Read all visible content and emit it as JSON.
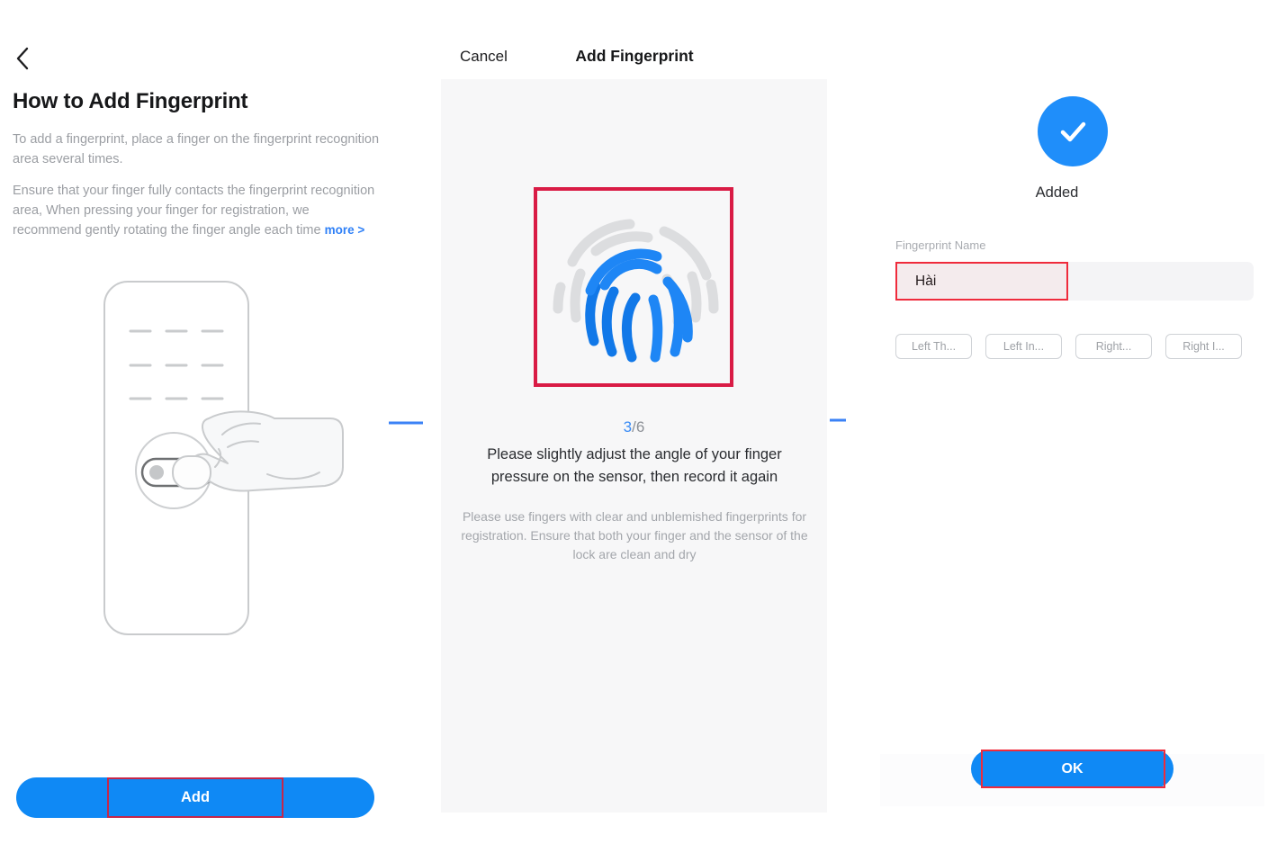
{
  "left_panel": {
    "back_icon": "chevron-left-icon",
    "title": "How to Add Fingerprint",
    "paragraph_1": "To add a fingerprint, place a finger on the fingerprint recognition area several times.",
    "paragraph_2": "Ensure that your finger fully contacts the fingerprint recognition area,  When pressing your finger for registration, we recommend gently rotating the finger angle each time ",
    "more_link": "more >",
    "illustration_name": "smart-lock-fingerprint-illustration",
    "add_button": "Add"
  },
  "middle_panel": {
    "cancel_label": "Cancel",
    "title": "Add Fingerprint",
    "fingerprint_icon": "fingerprint-icon",
    "counter_current": "3",
    "counter_separator": "/",
    "counter_total": "6",
    "instruction": "Please slightly adjust the angle of your finger pressure on the sensor, then record it again",
    "note": "Please use fingers with clear and unblemished fingerprints for registration. Ensure that both your finger and the sensor of the lock are clean and dry"
  },
  "right_panel": {
    "check_icon": "check-circle-icon",
    "status_label": "Added",
    "field_label": "Fingerprint Name",
    "field_value": "Hài",
    "field_placeholder": "Fingerprint Name",
    "chips": [
      {
        "label": "Left Th..."
      },
      {
        "label": "Left In..."
      },
      {
        "label": "Right..."
      },
      {
        "label": "Right I..."
      }
    ],
    "ok_button": "OK"
  },
  "arrows": [
    {
      "name": "flow-arrow-1"
    },
    {
      "name": "flow-arrow-2"
    }
  ],
  "colors": {
    "accent_blue": "#0f89f5",
    "link_blue": "#2f80f7",
    "counter_blue": "#3b8cf5",
    "success_blue": "#1f8efa",
    "annotation_red": "#ef2b3c",
    "annotation_crimson": "#d91b45",
    "sheet_gray": "#f7f7f8",
    "field_gray": "#f4f4f6",
    "muted_text": "#9b9ea3",
    "body_text": "#2a2c30"
  }
}
